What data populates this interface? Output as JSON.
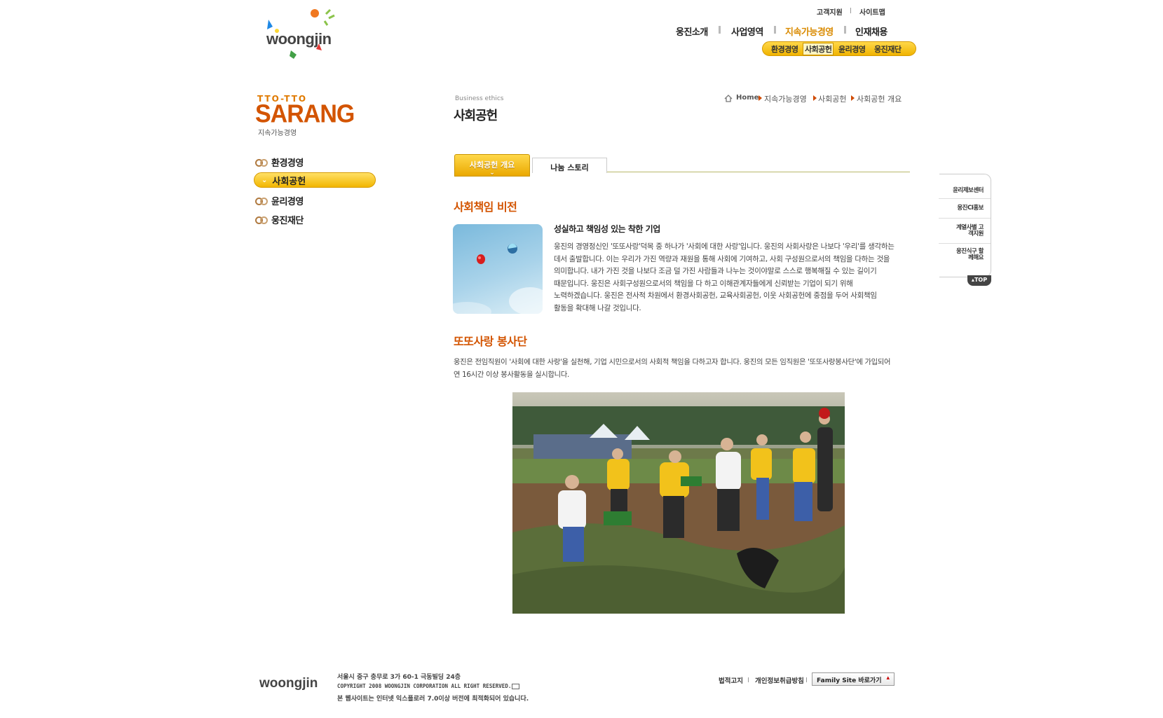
{
  "header": {
    "logo_text": "woongjin",
    "util_links": [
      "고객지원",
      "사이트맵"
    ],
    "gnb": [
      "웅진소개",
      "사업영역",
      "지속가능경영",
      "인재채용"
    ],
    "gnb_active": "지속가능경영",
    "subnav": [
      "환경경영",
      "사회공헌",
      "윤리경영",
      "웅진재단"
    ],
    "subnav_active": "사회공헌"
  },
  "sidebar": {
    "brand_top": "TTO-TTO",
    "brand_main": "SARANG",
    "brand_sub": "지속가능경영",
    "items": [
      {
        "label": "환경경영"
      },
      {
        "label": "사회공헌"
      },
      {
        "label": "윤리경영"
      },
      {
        "label": "웅진재단"
      }
    ],
    "active_label": "사회공헌"
  },
  "content": {
    "section_en": "Business ethics",
    "title": "사회공헌",
    "breadcrumb": [
      "Home",
      "지속가능경영",
      "사회공헌",
      "사회공헌 개요"
    ],
    "tabs": [
      {
        "label": "사회공헌 개요",
        "active": true
      },
      {
        "label": "나눔 스토리",
        "active": false
      }
    ],
    "vision": {
      "heading": "사회책임 비전",
      "subhead": "성실하고 책임성 있는 착한 기업",
      "lines": [
        "웅진의 경영정신인 '또또사랑'덕목 중 하나가 '사회에 대한 사랑'입니다. 웅진의 사회사랑은 나보다 '우리'를 생각하는",
        "데서 출발합니다. 이는 우리가 가진 역량과 재원을 통해 사회에 기여하고, 사회 구성원으로서의 책임을 다하는 것을",
        "의미합니다. 내가 가진 것을 나보다 조금 덜 가진 사람들과 나누는 것이야말로 스스로 행복해질 수 있는 길이기",
        "때문입니다. 웅진은 사회구성원으로서의 책임을 다 하고 이해관계자들에게 신뢰받는 기업이 되기 위해",
        "노력하겠습니다. 웅진은 전사적 차원에서 환경사회공헌, 교육사회공헌, 이웃 사회공헌에 중점을 두어 사회책임",
        "활동을 확대해 나갈 것입니다."
      ]
    },
    "volunteer": {
      "heading": "또또사랑 봉사단",
      "lines": [
        "웅진은 전임직원이 '사회에 대한 사랑'을 실천해, 기업 시민으로서의 사회적 책임을 다하고자 합니다. 웅진의 모든 임직원은 '또또사랑봉사단'에 가입되어",
        "연 16시간 이상 봉사활동을 실시합니다."
      ]
    }
  },
  "quick_menu": {
    "items": [
      "윤리제보센터",
      "웅진CI홍보",
      "계열사별 고객지원",
      "웅진식구 할께해요"
    ],
    "top_label": "TOP"
  },
  "footer": {
    "logo_text": "woongjin",
    "address": "서울시 중구 충무로 3가 60-1 극동빌딩 24층",
    "copyright": "COPYRIGHT 2008 WOONGJIN CORPORATION ALL RIGHT RESERVED.",
    "notice": "본 웹사이트는 인터넷 익스플로러 7.0이상 버전에 최적화되어 있습니다.",
    "links": [
      "법적고지",
      "개인정보취급방침"
    ],
    "family_site": "Family Site 바로가기"
  },
  "colors": {
    "accent": "#f2b600",
    "heading": "#d35400"
  }
}
